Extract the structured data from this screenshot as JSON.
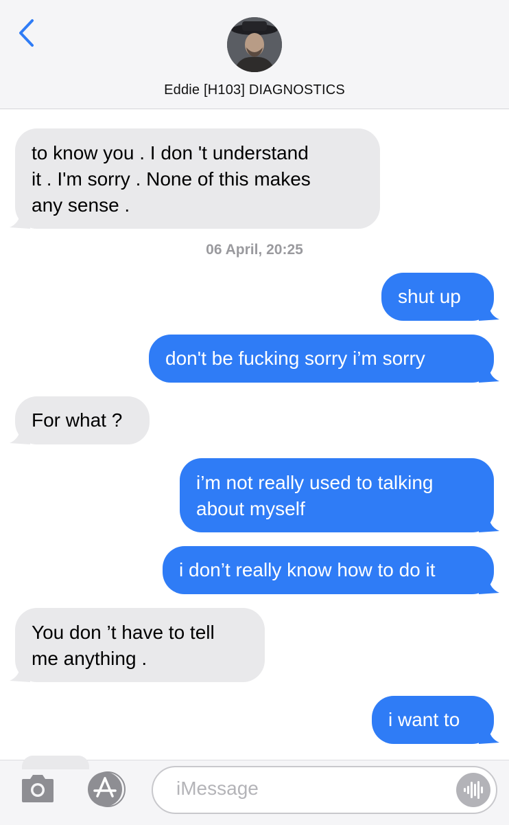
{
  "header": {
    "back_icon": "chevron-left-icon",
    "contact_name": "Eddie [H103] DIAGNOSTICS",
    "avatar_icon": "contact-avatar"
  },
  "colors": {
    "accent": "#2f7cf6",
    "incoming_bubble": "#e9e9eb",
    "header_bg": "#f5f5f7",
    "timestamp": "#9a9a9e"
  },
  "conversation": {
    "timestamp": "06 April, 20:25",
    "messages": [
      {
        "direction": "incoming",
        "lines": [
          "to know you  . I don 't understand",
          "it . I'm sorry . None of this makes",
          "any sense ."
        ]
      },
      {
        "direction": "outgoing",
        "lines": [
          "shut up"
        ]
      },
      {
        "direction": "outgoing",
        "lines": [
          "don't be fucking sorry i’m sorry"
        ]
      },
      {
        "direction": "incoming",
        "lines": [
          "For what ?"
        ]
      },
      {
        "direction": "outgoing",
        "lines": [
          "i’m not really used to talking",
          "about myself"
        ]
      },
      {
        "direction": "outgoing",
        "lines": [
          "i don’t really know how to do it"
        ]
      },
      {
        "direction": "incoming",
        "lines": [
          "You don ’t have to tell",
          "me anything ."
        ]
      },
      {
        "direction": "outgoing",
        "lines": [
          "i want to"
        ]
      }
    ]
  },
  "input_bar": {
    "camera_icon": "camera-icon",
    "apps_icon": "app-store-icon",
    "placeholder": "iMessage",
    "audio_icon": "audio-waveform-icon"
  }
}
